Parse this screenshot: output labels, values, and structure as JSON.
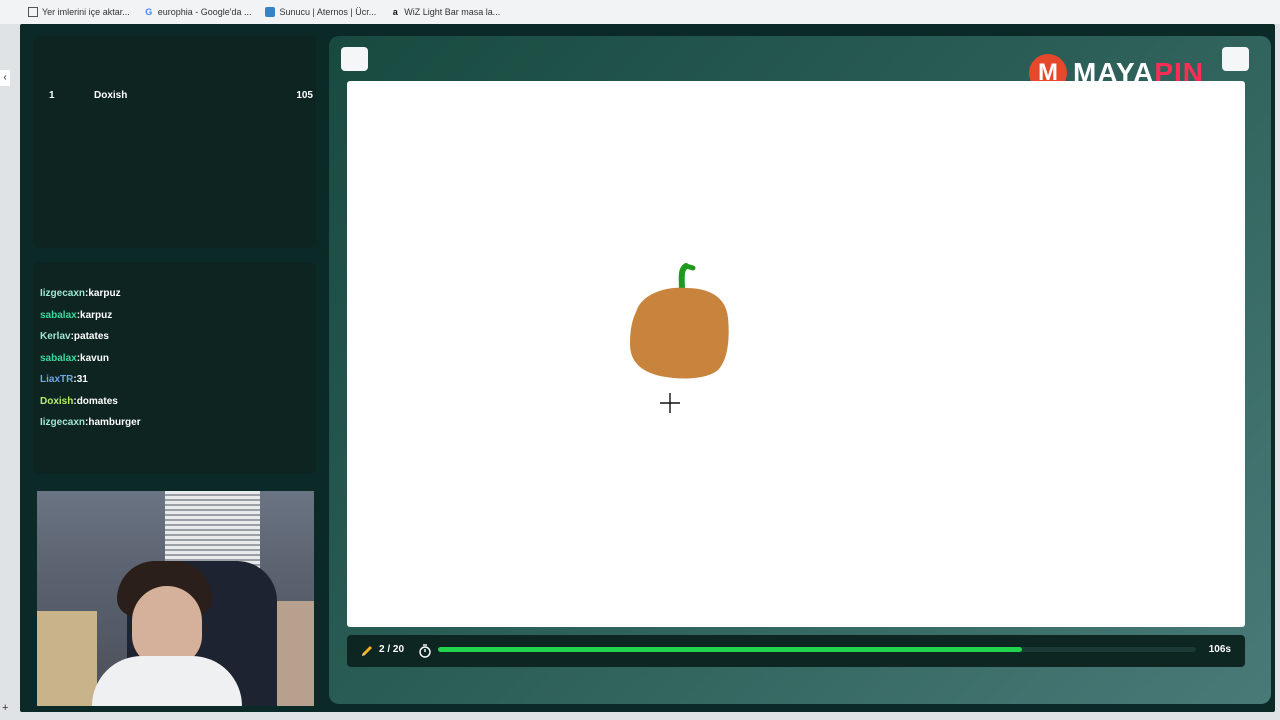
{
  "bookmarks": [
    {
      "label": "Yer imlerini içe aktar...",
      "icon": "import-icon"
    },
    {
      "label": "europhia - Google'da ...",
      "icon": "google-icon"
    },
    {
      "label": "Sunucu | Aternos | Ücr...",
      "icon": "aternos-icon"
    },
    {
      "label": "WiZ Light Bar masa la...",
      "icon": "amazon-icon"
    }
  ],
  "scoreboard": [
    {
      "rank": "1",
      "name": "Doxish",
      "points": "105"
    }
  ],
  "chat": [
    {
      "user": "Iizgecaxn",
      "sep": ":",
      "message": "karpuz",
      "color": "#9ee6d2"
    },
    {
      "user": "sabalax",
      "sep": ":",
      "message": "karpuz",
      "color": "#3ad9a0"
    },
    {
      "user": "Kerlav",
      "sep": ":",
      "message": "patates",
      "color": "#9ee6d2"
    },
    {
      "user": "sabalax",
      "sep": ":",
      "message": "kavun",
      "color": "#3ad9a0"
    },
    {
      "user": "LiaxTR",
      "sep": ":",
      "message": "31",
      "color": "#6fa6e8"
    },
    {
      "user": "Doxish",
      "sep": ":",
      "message": "domates",
      "color": "#b8ef6a"
    },
    {
      "user": "Iizgecaxn",
      "sep": ":",
      "message": "hamburger",
      "color": "#9ee6d2"
    }
  ],
  "logo": {
    "part1": "MAYA",
    "part2": "PIN",
    "mark": "M"
  },
  "status": {
    "round": "2 / 20",
    "progress_percent": 77,
    "time_left": "106s",
    "progress_color": "#22d34f"
  },
  "colors": {
    "accent": "#22d34f",
    "brand": "#ff2d55",
    "pumpkin": "#c8843c",
    "stem": "#1f9a1f"
  }
}
